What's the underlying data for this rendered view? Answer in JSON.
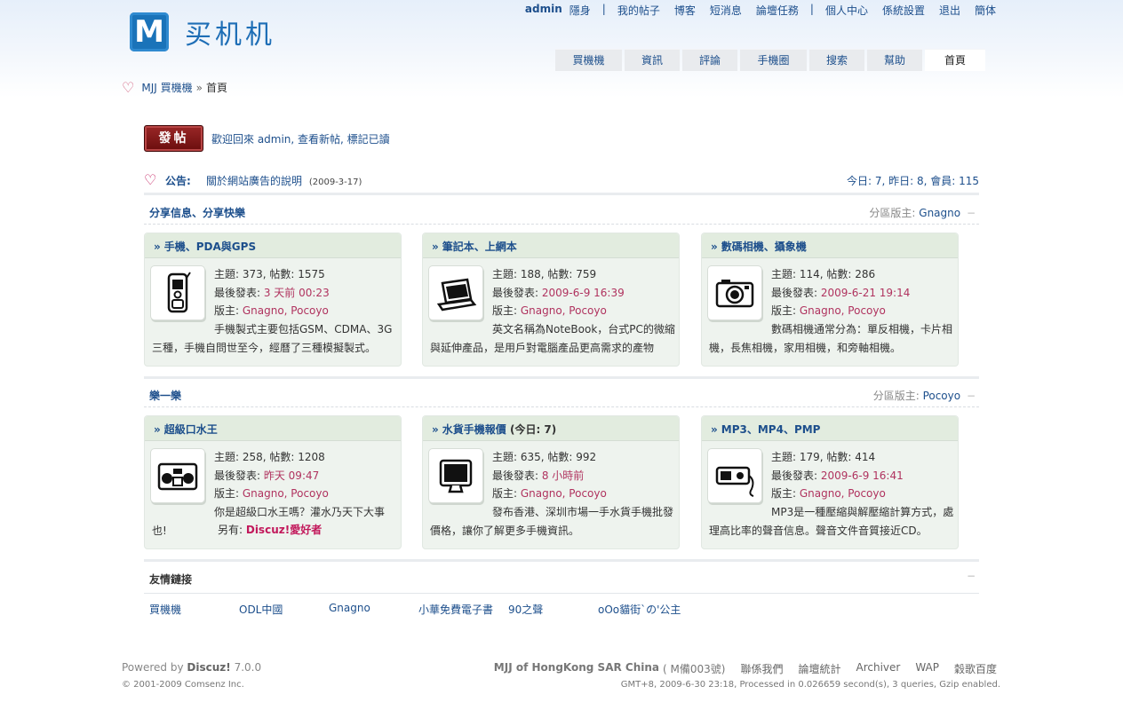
{
  "logo": {
    "mark": "M",
    "text": "买机机"
  },
  "user_menu": {
    "username": "admin",
    "hide": "隱身",
    "items": [
      "我的帖子",
      "博客",
      "短消息",
      "論壇任務"
    ],
    "items2": [
      "個人中心",
      "係統設置",
      "退出",
      "簡体"
    ]
  },
  "nav": {
    "tabs": [
      {
        "label": "買機機"
      },
      {
        "label": "資訊"
      },
      {
        "label": "評論"
      },
      {
        "label": "手機圈"
      },
      {
        "label": "搜索"
      },
      {
        "label": "幫助"
      },
      {
        "label": "首頁"
      }
    ]
  },
  "breadcrumb": {
    "root": "MJJ 買機機",
    "sep": "»",
    "current": "首頁"
  },
  "post_button": "發帖",
  "welcome": "歡迎回來 admin, 查看新帖, 標記已讀",
  "announcement": {
    "label": "公告:",
    "title": "關於網站廣告的說明",
    "date": "(2009-3-17)",
    "stats": "今日: 7, 昨日: 8, 會員: 115"
  },
  "sections": [
    {
      "title": "分享信息、分享快樂",
      "mod_label": "分區版主:",
      "mod_name": "Gnagno",
      "forums": [
        {
          "name": "手機、PDA與GPS",
          "icon": "phone-icon",
          "topics": "主題: 373, 帖數: 1575",
          "last_label": "最後發表: ",
          "last": "3 天前 00:23",
          "mods_label": "版主: ",
          "mods": "Gnagno, Pocoyo",
          "desc": "手機製式主要包括GSM、CDMA、3G三種，手機自問世至今，經曆了三種模擬製式。"
        },
        {
          "name": "筆記本、上網本",
          "icon": "laptop-icon",
          "topics": "主題: 188, 帖數: 759",
          "last_label": "最後發表: ",
          "last": "2009-6-9 16:39",
          "mods_label": "版主: ",
          "mods": "Gnagno, Pocoyo",
          "desc": "英文名稱為NoteBook，台式PC的微縮與延伸產品，是用戶對電腦產品更高需求的產物"
        },
        {
          "name": "數碼相機、攝象機",
          "icon": "camera-icon",
          "topics": "主題: 114, 帖數: 286",
          "last_label": "最後發表: ",
          "last": "2009-6-21 19:14",
          "mods_label": "版主: ",
          "mods": "Gnagno, Pocoyo",
          "desc": "數碼相機通常分為：單反相機，卡片相機，長焦相機，家用相機，和旁軸相機。"
        }
      ]
    },
    {
      "title": "樂一樂",
      "mod_label": "分區版主:",
      "mod_name": "Pocoyo",
      "forums": [
        {
          "name": "超級口水王",
          "icon": "stereo-icon",
          "topics": "主題: 258, 帖數: 1208",
          "last_label": "最後發表: ",
          "last": "昨天 09:47",
          "mods_label": "版主: ",
          "mods": "Gnagno, Pocoyo",
          "desc": "你是超級口水王嗎？灌水乃天下大事也!",
          "extra_label": "另有: ",
          "extra": "Discuz!愛好者"
        },
        {
          "name": "水貨手機報價",
          "today": " (今日: 7)",
          "icon": "monitor-icon",
          "topics": "主題: 635, 帖數: 992",
          "last_label": "最後發表: ",
          "last": "8 小時前",
          "mods_label": "版主: ",
          "mods": "Gnagno, Pocoyo",
          "desc": "發布香港、深圳市場一手水貨手機批發價格，讓你了解更多手機資訊。"
        },
        {
          "name": "MP3、MP4、PMP",
          "icon": "mp3-player-icon",
          "topics": "主題: 179, 帖數: 414",
          "last_label": "最後發表: ",
          "last": "2009-6-9 16:41",
          "mods_label": "版主: ",
          "mods": "Gnagno, Pocoyo",
          "desc": "MP3是一種壓縮與解壓縮計算方式，處理高比率的聲音信息。聲音文件音質接近CD。"
        }
      ]
    }
  ],
  "links": {
    "title": "友情鏈接",
    "items": [
      "買機機",
      "ODL中國",
      "Gnagno",
      "小華免費電子書",
      "90之聲",
      "oOo貓街ˋの'公主"
    ]
  },
  "footer": {
    "powered": "Powered by",
    "product": "Discuz!",
    "version": "7.0.0",
    "copyright": "© 2001-2009 Comsenz Inc.",
    "site": "MJJ of HongKong SAR China",
    "icp": "( M備003號)",
    "links": [
      "聯係我們",
      "論壇統計",
      "Archiver",
      "WAP",
      "穀歌百度"
    ],
    "process": "GMT+8, 2009-6-30 23:18, Processed in 0.026659 second(s), 3 queries, Gzip enabled."
  }
}
